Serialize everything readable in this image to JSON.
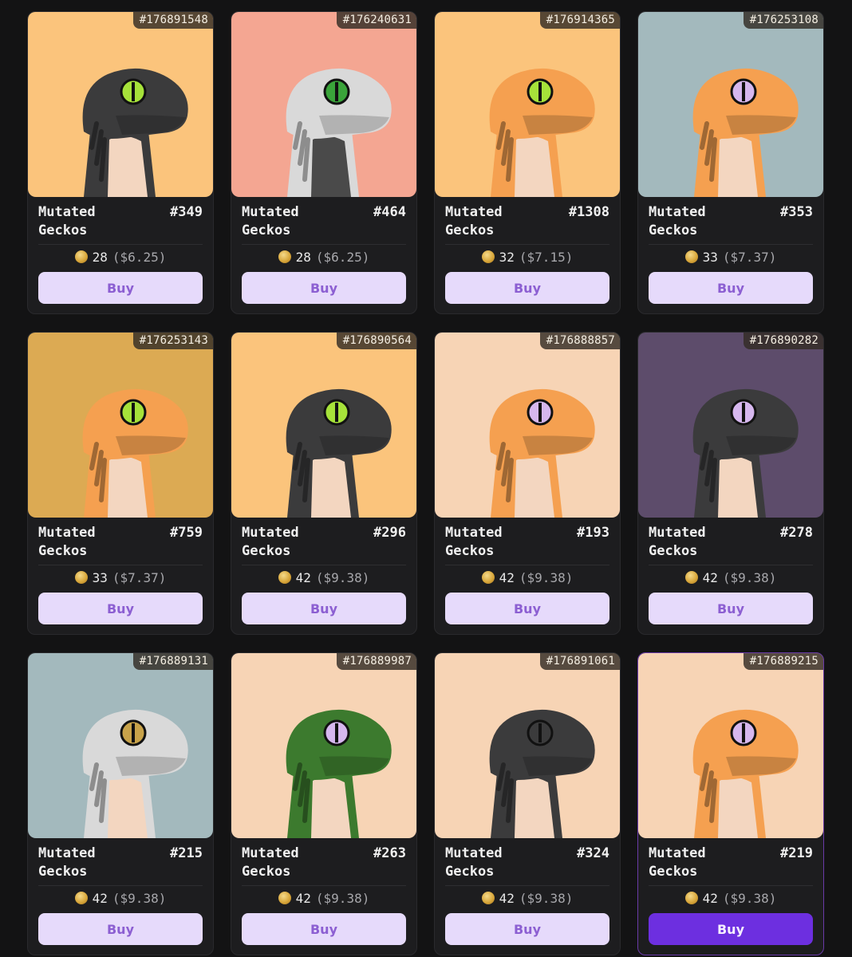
{
  "cards": [
    {
      "inscription": "#176891548",
      "name": "Mutated Geckos",
      "number": "#349",
      "price": "28",
      "usd": "($6.25)",
      "buy": "Buy",
      "bg": "#fbc47c",
      "skin": "#3b3b3c",
      "tone": "#f3d6c0",
      "eye": "#a6e23a",
      "selected": false
    },
    {
      "inscription": "#176240631",
      "name": "Mutated Geckos",
      "number": "#464",
      "price": "28",
      "usd": "($6.25)",
      "buy": "Buy",
      "bg": "#f4a692",
      "skin": "#d9d9d9",
      "tone": "#4a4a4a",
      "eye": "#3aa43a",
      "selected": false
    },
    {
      "inscription": "#176914365",
      "name": "Mutated Geckos",
      "number": "#1308",
      "price": "32",
      "usd": "($7.15)",
      "buy": "Buy",
      "bg": "#fbc47c",
      "skin": "#f5a050",
      "tone": "#f3d6c0",
      "eye": "#a6e23a",
      "selected": false
    },
    {
      "inscription": "#176253108",
      "name": "Mutated Geckos",
      "number": "#353",
      "price": "33",
      "usd": "($7.37)",
      "buy": "Buy",
      "bg": "#a3b9bd",
      "skin": "#f5a050",
      "tone": "#f3d6c0",
      "eye": "#d6b7ee",
      "selected": false
    },
    {
      "inscription": "#176253143",
      "name": "Mutated Geckos",
      "number": "#759",
      "price": "33",
      "usd": "($7.37)",
      "buy": "Buy",
      "bg": "#dcaa53",
      "skin": "#f5a050",
      "tone": "#f3d6c0",
      "eye": "#a6e23a",
      "selected": false
    },
    {
      "inscription": "#176890564",
      "name": "Mutated Geckos",
      "number": "#296",
      "price": "42",
      "usd": "($9.38)",
      "buy": "Buy",
      "bg": "#fbc47c",
      "skin": "#3b3b3c",
      "tone": "#f3d6c0",
      "eye": "#a6e23a",
      "selected": false
    },
    {
      "inscription": "#176888857",
      "name": "Mutated Geckos",
      "number": "#193",
      "price": "42",
      "usd": "($9.38)",
      "buy": "Buy",
      "bg": "#f7d4b5",
      "skin": "#f5a050",
      "tone": "#f3d6c0",
      "eye": "#d6b7ee",
      "selected": false
    },
    {
      "inscription": "#176890282",
      "name": "Mutated Geckos",
      "number": "#278",
      "price": "42",
      "usd": "($9.38)",
      "buy": "Buy",
      "bg": "#5d4c6b",
      "skin": "#3b3b3c",
      "tone": "#f3d6c0",
      "eye": "#d6b7ee",
      "selected": false
    },
    {
      "inscription": "#176889131",
      "name": "Mutated Geckos",
      "number": "#215",
      "price": "42",
      "usd": "($9.38)",
      "buy": "Buy",
      "bg": "#a3b9bd",
      "skin": "#d9d9d9",
      "tone": "#f3d6c0",
      "eye": "#c8a34a",
      "selected": false
    },
    {
      "inscription": "#176889987",
      "name": "Mutated Geckos",
      "number": "#263",
      "price": "42",
      "usd": "($9.38)",
      "buy": "Buy",
      "bg": "#f7d4b5",
      "skin": "#3c7a2e",
      "tone": "#f3d6c0",
      "eye": "#d6b7ee",
      "selected": false
    },
    {
      "inscription": "#176891061",
      "name": "Mutated Geckos",
      "number": "#324",
      "price": "42",
      "usd": "($9.38)",
      "buy": "Buy",
      "bg": "#f7d4b5",
      "skin": "#3b3b3c",
      "tone": "#f3d6c0",
      "eye": "#3b3b3c",
      "selected": false
    },
    {
      "inscription": "#176889215",
      "name": "Mutated Geckos",
      "number": "#219",
      "price": "42",
      "usd": "($9.38)",
      "buy": "Buy",
      "bg": "#f7d4b5",
      "skin": "#f5a050",
      "tone": "#f3d6c0",
      "eye": "#d6b7ee",
      "selected": true
    }
  ]
}
